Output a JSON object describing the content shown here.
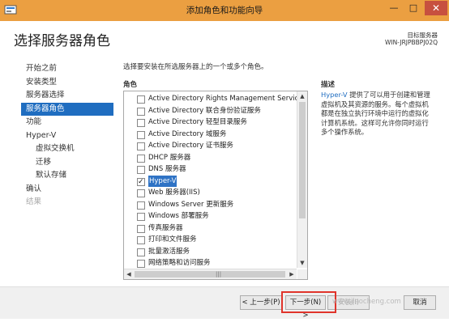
{
  "window": {
    "title": "添加角色和功能向导",
    "controls": {
      "minimize": "—",
      "maximize": "□",
      "close": "✕"
    },
    "accent_color": "#eb9f41"
  },
  "header": {
    "page_title": "选择服务器角色",
    "destination_label": "目标服务器",
    "destination_server": "WIN-JRJPBBPJ02Q"
  },
  "nav": {
    "items": [
      {
        "label": "开始之前",
        "state": "normal"
      },
      {
        "label": "安装类型",
        "state": "normal"
      },
      {
        "label": "服务器选择",
        "state": "normal"
      },
      {
        "label": "服务器角色",
        "state": "active"
      },
      {
        "label": "功能",
        "state": "normal"
      },
      {
        "label": "Hyper-V",
        "state": "normal"
      },
      {
        "label": "虚拟交换机",
        "state": "sub"
      },
      {
        "label": "迁移",
        "state": "sub"
      },
      {
        "label": "默认存储",
        "state": "sub"
      },
      {
        "label": "确认",
        "state": "normal"
      },
      {
        "label": "结果",
        "state": "disabled"
      }
    ]
  },
  "main": {
    "instruction": "选择要安装在所选服务器上的一个或多个角色。",
    "roles_header": "角色",
    "description_header": "描述",
    "roles": [
      {
        "label": "Active Directory Rights Management Services",
        "checked": false
      },
      {
        "label": "Active Directory 联合身份验证服务",
        "checked": false
      },
      {
        "label": "Active Directory 轻型目录服务",
        "checked": false
      },
      {
        "label": "Active Directory 域服务",
        "checked": false
      },
      {
        "label": "Active Directory 证书服务",
        "checked": false
      },
      {
        "label": "DHCP 服务器",
        "checked": false
      },
      {
        "label": "DNS 服务器",
        "checked": false
      },
      {
        "label": "Hyper-V",
        "checked": true,
        "selected": true
      },
      {
        "label": "Web 服务器(IIS)",
        "checked": false
      },
      {
        "label": "Windows Server 更新服务",
        "checked": false
      },
      {
        "label": "Windows 部署服务",
        "checked": false
      },
      {
        "label": "传真服务器",
        "checked": false
      },
      {
        "label": "打印和文件服务",
        "checked": false
      },
      {
        "label": "批量激活服务",
        "checked": false
      },
      {
        "label": "网络策略和访问服务",
        "checked": false
      }
    ],
    "description_highlight": "Hyper-V",
    "description_rest": " 提供了可以用于创建和管理虚拟机及其资源的服务。每个虚拟机都是在独立执行环境中运行的虚拟化计算机系统。这样可允许你同时运行多个操作系统。"
  },
  "footer": {
    "prev_label": "< 上一步(P)",
    "next_label": "下一步(N) >",
    "install_label": "安装(I)",
    "cancel_label": "取消",
    "watermark": "www.jiaocheng.com"
  }
}
